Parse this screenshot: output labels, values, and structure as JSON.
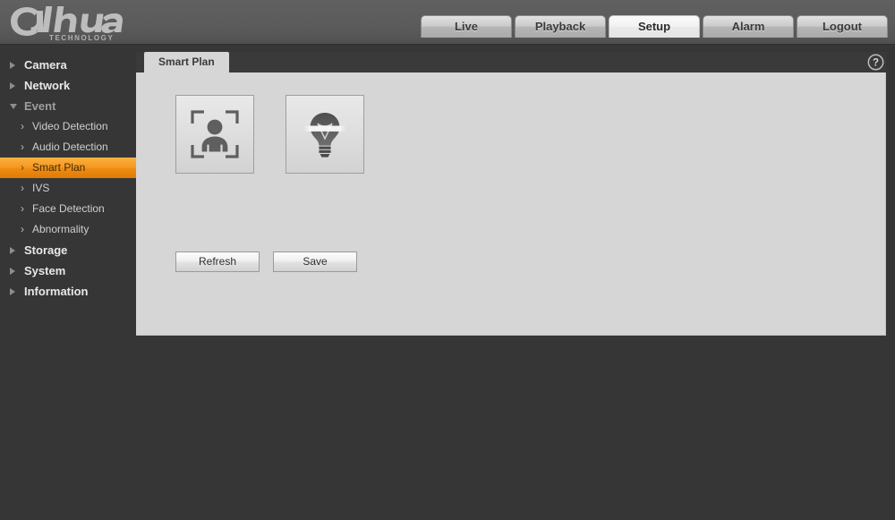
{
  "header": {
    "brand_name": "alhua",
    "brand_sub": "TECHNOLOGY",
    "tabs": [
      {
        "label": "Live",
        "active": false
      },
      {
        "label": "Playback",
        "active": false
      },
      {
        "label": "Setup",
        "active": true
      },
      {
        "label": "Alarm",
        "active": false
      },
      {
        "label": "Logout",
        "active": false
      }
    ]
  },
  "sidebar": {
    "groups": [
      {
        "label": "Camera",
        "expanded": false,
        "items": []
      },
      {
        "label": "Network",
        "expanded": false,
        "items": []
      },
      {
        "label": "Event",
        "expanded": true,
        "items": [
          {
            "label": "Video Detection",
            "active": false
          },
          {
            "label": "Audio Detection",
            "active": false
          },
          {
            "label": "Smart Plan",
            "active": true
          },
          {
            "label": "IVS",
            "active": false
          },
          {
            "label": "Face Detection",
            "active": false
          },
          {
            "label": "Abnormality",
            "active": false
          }
        ]
      },
      {
        "label": "Storage",
        "expanded": false,
        "items": []
      },
      {
        "label": "System",
        "expanded": false,
        "items": []
      },
      {
        "label": "Information",
        "expanded": false,
        "items": []
      }
    ]
  },
  "content": {
    "tab_label": "Smart Plan",
    "help_icon": "question-mark-icon",
    "tiles": [
      {
        "icon": "face-detection-icon",
        "selected": false
      },
      {
        "icon": "lightbulb-ivs-icon",
        "selected": false
      }
    ],
    "buttons": {
      "refresh_label": "Refresh",
      "save_label": "Save"
    }
  },
  "colors": {
    "accent_orange": "#f59a23",
    "page_background": "#363636",
    "header_gray": "#5b5b5b",
    "panel_gray": "#d6d6d6"
  }
}
